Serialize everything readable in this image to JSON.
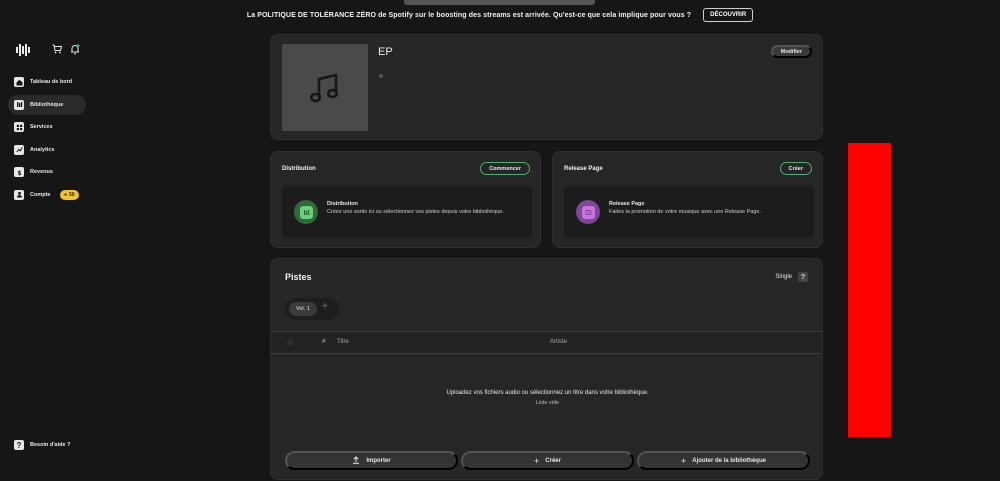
{
  "banner": {
    "text": "La POLITIQUE DE TOLÉRANCE ZÉRO de Spotify sur le boosting des streams est arrivée. Qu'est-ce que cela implique pour vous ?",
    "button": "DÉCOUVRIR"
  },
  "sidebar": {
    "items": [
      {
        "label": "Tableau de bord",
        "icon": "home-icon"
      },
      {
        "label": "Bibliothèque",
        "icon": "library-icon",
        "active": true
      },
      {
        "label": "Services",
        "icon": "grid-icon"
      },
      {
        "label": "Analytics",
        "icon": "chart-icon"
      },
      {
        "label": "Revenus",
        "icon": "dollar-icon"
      },
      {
        "label": "Compte",
        "icon": "user-icon",
        "badge": "50"
      }
    ],
    "help": "Besoin d'aide ?"
  },
  "release": {
    "title": "EP",
    "modify": "Modifier"
  },
  "distribution": {
    "title": "Distribution",
    "button": "Commencer",
    "card_title": "Distribution",
    "card_desc": "Créez une sortie ici ou sélectionnez vos pistes depuis votre bibliothèque."
  },
  "release_page": {
    "title": "Release Page",
    "button": "Créer",
    "card_title": "Release Page",
    "card_desc": "Faites la promotion de votre musique avec une Release Page."
  },
  "tracks": {
    "title": "Pistes",
    "type": "Single",
    "help": "?",
    "volume_tab": "Vol. 1",
    "add": "+",
    "columns": {
      "number": "#",
      "title": "Titre",
      "artist": "Artiste"
    },
    "empty_message": "Uploadez vos fichiers audio ou sélectionnez un titre dans votre bibliothèque.",
    "empty_sub": "Liste vide",
    "actions": {
      "import": "Importer",
      "create": "Créer",
      "add_from_library": "Ajouter de la bibliothèque"
    }
  },
  "colors": {
    "background": "#161616",
    "panel": "#262626",
    "accent_green": "#4caf73",
    "badge": "#f2c230",
    "red_block": "#ff0000"
  }
}
